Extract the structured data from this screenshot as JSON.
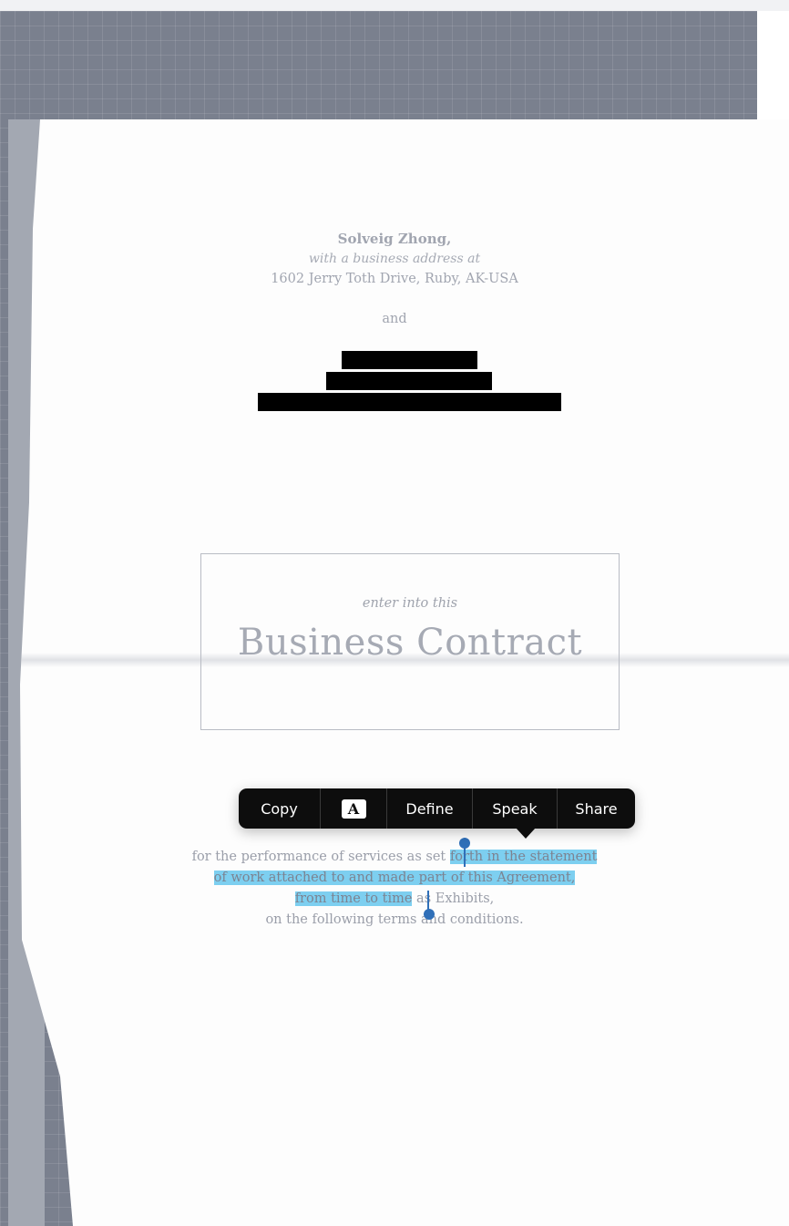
{
  "party_one": {
    "name": "Solveig Zhong,",
    "tagline": "with a business address at",
    "address": "1602 Jerry Toth Drive, Ruby, AK-USA"
  },
  "conjunction": "and",
  "heading": {
    "subtitle": "enter into this",
    "title": "Business Contract"
  },
  "context_menu": {
    "copy": "Copy",
    "format_icon": "A",
    "define": "Define",
    "speak": "Speak",
    "share": "Share"
  },
  "body": {
    "line1_plain": "for the performance of services as set ",
    "line1_selected": "forth in the statement",
    "line2_selected": "of work attached to and made part of this Agreement,",
    "line3_selected": "from time to time",
    "line3_plain": " as Exhibits,",
    "line4": "on the following terms and conditions."
  },
  "colors": {
    "selection": "#7dcff0",
    "selection_handle": "#2f6fb8",
    "menu_background": "#0d0d0d"
  },
  "icons": [
    "font-format-icon",
    "selection-start-handle",
    "selection-end-handle"
  ]
}
